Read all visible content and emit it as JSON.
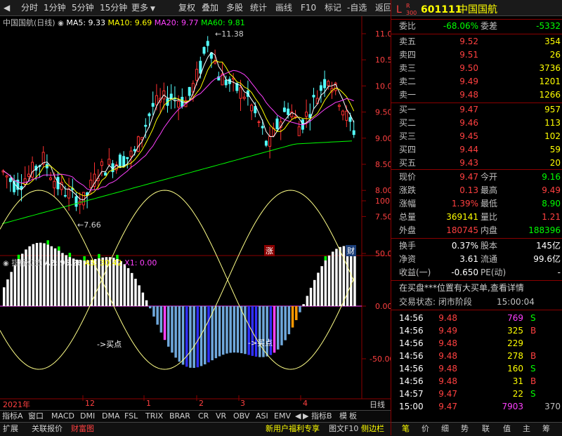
{
  "toolbar": {
    "left_items": [
      "分时",
      "1分钟",
      "5分钟",
      "15分钟",
      "更多"
    ],
    "right_items": [
      "复权",
      "叠加",
      "多股",
      "统计",
      "画线",
      "F10",
      "标记",
      "-自选",
      "返回"
    ]
  },
  "stock": {
    "badge_top": "L",
    "badge_r": "R",
    "badge_num": "300",
    "code": "601111",
    "name": "中国国航"
  },
  "kline": {
    "title": "中国国航(日线)",
    "ma": [
      {
        "label": "MA5: 9.33",
        "color": "#ffffff"
      },
      {
        "label": "MA10: 9.69",
        "color": "#ffff00"
      },
      {
        "label": "MA20: 9.77",
        "color": "#ff40ff"
      },
      {
        "label": "MA60: 9.81",
        "color": "#00ff00"
      }
    ],
    "high_label": "11.38",
    "low_label": "7.66",
    "price_axis": [
      "11.00",
      "10.50",
      "10.00",
      "9.50",
      "9.00",
      "8.50",
      "8.00",
      "7.50"
    ],
    "marker_zhang": "涨",
    "marker_cai": "财"
  },
  "indicator": {
    "title": "指标公式",
    "values": [
      {
        "label": "A2: 95.26",
        "color": "#ffffff"
      },
      {
        "label": "A3: 30.42",
        "color": "#ffff00"
      },
      {
        "label": "X1: 0.00",
        "color": "#ff40ff"
      }
    ],
    "axis": [
      "100.0",
      "50.00",
      "0.00",
      "-50.00"
    ],
    "buy_label_1": "->买点",
    "buy_label_2": "->买点"
  },
  "timeline": {
    "labels": [
      "2021年",
      "12",
      "1",
      "2",
      "3",
      "4"
    ],
    "period": "日线"
  },
  "order_book": {
    "webi_label": "委比",
    "webi_value": "-68.06%",
    "wecha_label": "委差",
    "wecha_value": "-5332",
    "sells": [
      {
        "label": "卖五",
        "price": "9.52",
        "vol": "354"
      },
      {
        "label": "卖四",
        "price": "9.51",
        "vol": "26"
      },
      {
        "label": "卖三",
        "price": "9.50",
        "vol": "3736"
      },
      {
        "label": "卖二",
        "price": "9.49",
        "vol": "1201"
      },
      {
        "label": "卖一",
        "price": "9.48",
        "vol": "1266"
      }
    ],
    "buys": [
      {
        "label": "买一",
        "price": "9.47",
        "vol": "957"
      },
      {
        "label": "买二",
        "price": "9.46",
        "vol": "113"
      },
      {
        "label": "买三",
        "price": "9.45",
        "vol": "102"
      },
      {
        "label": "买四",
        "price": "9.44",
        "vol": "59"
      },
      {
        "label": "买五",
        "price": "9.43",
        "vol": "20"
      }
    ]
  },
  "quote": [
    {
      "l1": "现价",
      "v1": "9.47",
      "c1": "red",
      "l2": "今开",
      "v2": "9.16",
      "c2": "green"
    },
    {
      "l1": "涨跌",
      "v1": "0.13",
      "c1": "red",
      "l2": "最高",
      "v2": "9.49",
      "c2": "red"
    },
    {
      "l1": "涨幅",
      "v1": "1.39%",
      "c1": "red",
      "l2": "最低",
      "v2": "8.90",
      "c2": "green"
    },
    {
      "l1": "总量",
      "v1": "369141",
      "c1": "yellow",
      "l2": "量比",
      "v2": "1.21",
      "c2": "red"
    },
    {
      "l1": "外盘",
      "v1": "180745",
      "c1": "red",
      "l2": "内盘",
      "v2": "188396",
      "c2": "green"
    }
  ],
  "quote2": [
    {
      "l1": "换手",
      "v1": "0.37%",
      "l2": "股本",
      "v2": "145亿"
    },
    {
      "l1": "净资",
      "v1": "3.61",
      "l2": "流通",
      "v2": "99.6亿"
    },
    {
      "l1": "收益(一)",
      "v1": "-0.650",
      "l2": "PE(动)",
      "v2": "-"
    }
  ],
  "notice": "在买盘***位置有大买单,查看详情",
  "trade_status": {
    "label": "交易状态: 闭市阶段",
    "time": "15:00:04"
  },
  "ticks": [
    {
      "t": "14:56",
      "p": "9.48",
      "v": "769",
      "d": "S",
      "vc": "magenta"
    },
    {
      "t": "14:56",
      "p": "9.49",
      "v": "325",
      "d": "B",
      "vc": "yellow"
    },
    {
      "t": "14:56",
      "p": "9.48",
      "v": "229",
      "d": "",
      "vc": "yellow"
    },
    {
      "t": "14:56",
      "p": "9.48",
      "v": "278",
      "d": "B",
      "vc": "yellow"
    },
    {
      "t": "14:56",
      "p": "9.48",
      "v": "160",
      "d": "S",
      "vc": "yellow"
    },
    {
      "t": "14:56",
      "p": "9.48",
      "v": "31",
      "d": "B",
      "vc": "yellow"
    },
    {
      "t": "14:57",
      "p": "9.47",
      "v": "22",
      "d": "S",
      "vc": "yellow"
    },
    {
      "t": "15:00",
      "p": "9.47",
      "v": "7903",
      "d": "",
      "vc": "magenta",
      "extra": "370"
    }
  ],
  "indicator_tabs": [
    "指标A",
    "窗口",
    "MACD",
    "DMI",
    "DMA",
    "FSL",
    "TRIX",
    "BRAR",
    "CR",
    "VR",
    "OBV",
    "ASI",
    "EMV"
  ],
  "indicator_tabs_right": [
    "指标B",
    "模",
    "板"
  ],
  "status_bar": {
    "left": [
      "扩展",
      "关联报价",
      "财富图"
    ],
    "promo": "新用户福利专享",
    "right": [
      "图文F10",
      "侧边栏"
    ],
    "buttons": [
      "笔",
      "价",
      "细",
      "势",
      "联",
      "值",
      "主",
      "筹"
    ]
  }
}
